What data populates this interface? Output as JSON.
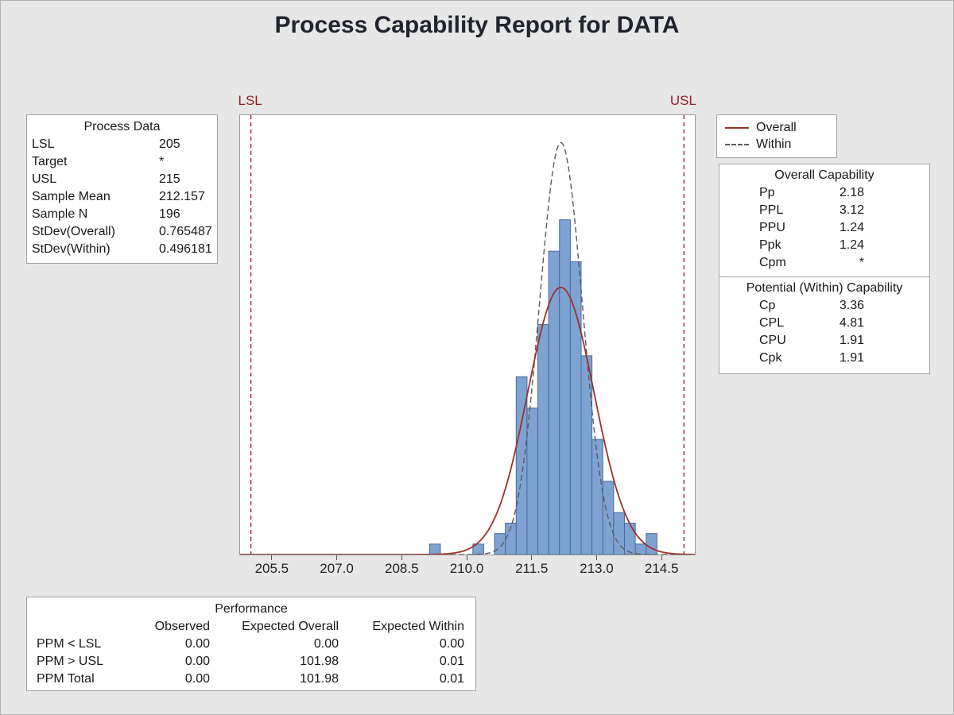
{
  "title": "Process Capability Report for DATA",
  "process_data": {
    "title": "Process Data",
    "rows": [
      {
        "label": "LSL",
        "value": "205"
      },
      {
        "label": "Target",
        "value": "*"
      },
      {
        "label": "USL",
        "value": "215"
      },
      {
        "label": "Sample Mean",
        "value": "212.157"
      },
      {
        "label": "Sample N",
        "value": "196"
      },
      {
        "label": "StDev(Overall)",
        "value": "0.765487"
      },
      {
        "label": "StDev(Within)",
        "value": "0.496181"
      }
    ]
  },
  "legend": {
    "overall_label": "Overall",
    "within_label": "Within"
  },
  "overall_capability": {
    "title": "Overall Capability",
    "rows": [
      {
        "label": "Pp",
        "value": "2.18"
      },
      {
        "label": "PPL",
        "value": "3.12"
      },
      {
        "label": "PPU",
        "value": "1.24"
      },
      {
        "label": "Ppk",
        "value": "1.24"
      },
      {
        "label": "Cpm",
        "value": "*"
      }
    ]
  },
  "within_capability": {
    "title": "Potential (Within) Capability",
    "rows": [
      {
        "label": "Cp",
        "value": "3.36"
      },
      {
        "label": "CPL",
        "value": "4.81"
      },
      {
        "label": "CPU",
        "value": "1.91"
      },
      {
        "label": "Cpk",
        "value": "1.91"
      }
    ]
  },
  "performance": {
    "title": "Performance",
    "columns": [
      "Observed",
      "Expected Overall",
      "Expected Within"
    ],
    "rows": [
      {
        "label": "PPM < LSL",
        "values": [
          "0.00",
          "0.00",
          "0.00"
        ]
      },
      {
        "label": "PPM > USL",
        "values": [
          "0.00",
          "101.98",
          "0.01"
        ]
      },
      {
        "label": "PPM Total",
        "values": [
          "0.00",
          "101.98",
          "0.01"
        ]
      }
    ]
  },
  "chart_data": {
    "type": "bar",
    "subtype": "capability-histogram",
    "title": "Process Capability Report for DATA",
    "xlabel": "",
    "ylabel": "",
    "x_range": [
      204.75,
      215.25
    ],
    "y_range": [
      0,
      42
    ],
    "x_ticks": [
      205.5,
      207.0,
      208.5,
      210.0,
      211.5,
      213.0,
      214.5
    ],
    "grid": false,
    "legend_position": "top-right",
    "bin_width": 0.25,
    "bins": {
      "centers": [
        209.25,
        210.25,
        210.75,
        211.0,
        211.25,
        211.5,
        211.75,
        212.0,
        212.25,
        212.5,
        212.75,
        213.0,
        213.25,
        213.5,
        213.75,
        214.0,
        214.25
      ],
      "frequencies": [
        1,
        1,
        2,
        3,
        17,
        14,
        22,
        29,
        32,
        28,
        19,
        11,
        7,
        4,
        3,
        1,
        2
      ]
    },
    "sample_n": 196,
    "lsl": {
      "label": "LSL",
      "value": 205
    },
    "usl": {
      "label": "USL",
      "value": 215
    },
    "curves": [
      {
        "name": "Overall",
        "mean": 212.157,
        "stdev": 0.765487,
        "style": "solid"
      },
      {
        "name": "Within",
        "mean": 212.157,
        "stdev": 0.496181,
        "style": "dashed"
      }
    ]
  },
  "colors": {
    "background": "#e7e7e7",
    "panel_border": "#a3a3a3",
    "bar_fill": "#7ea3d3",
    "bar_stroke": "#49699a",
    "overall_curve": "#9c3129",
    "within_curve": "#5a5a5a",
    "spec_line": "#8e1f24",
    "title_text": "#20242e"
  }
}
